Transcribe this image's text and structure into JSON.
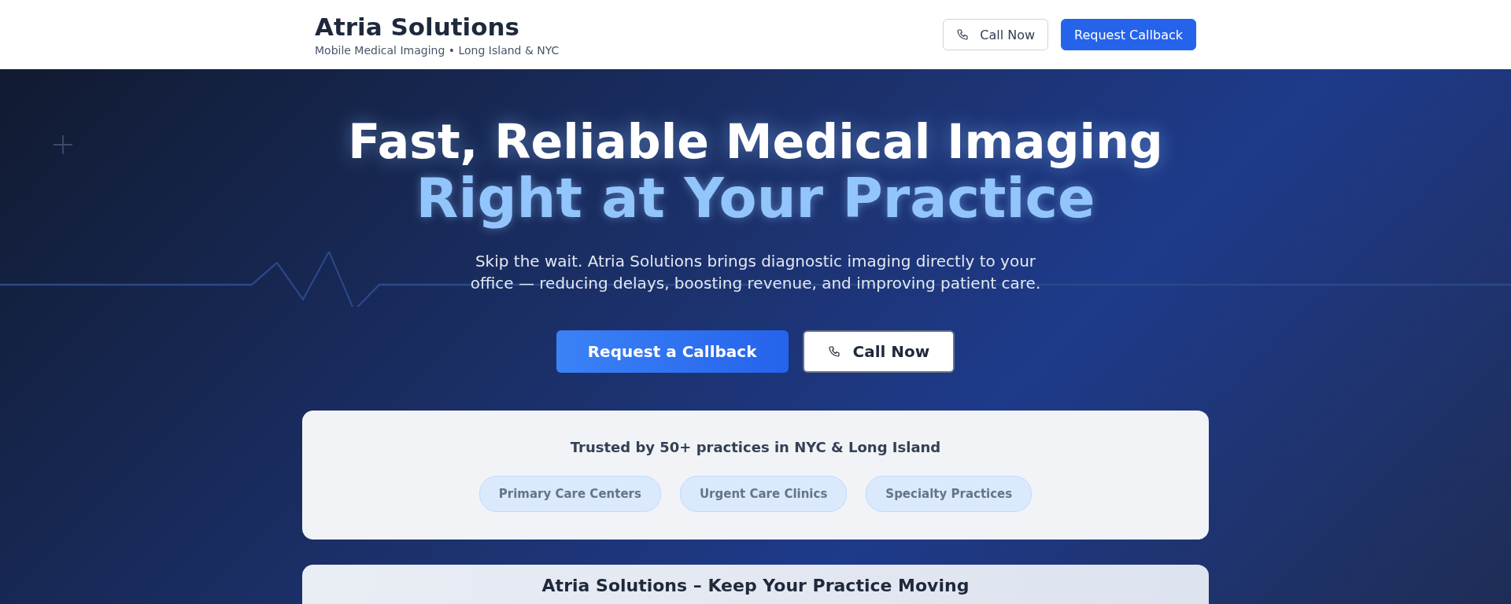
{
  "header": {
    "brand": "Atria Solutions",
    "tagline": "Mobile Medical Imaging • Long Island & NYC",
    "buttons": [
      {
        "label": "Call Now",
        "kind": "outline"
      },
      {
        "label": "Request Callback",
        "kind": "primary"
      }
    ]
  },
  "hero": {
    "title": "Fast, Reliable Medical Imaging",
    "highlight": "Right at Your Practice",
    "description": "Skip the wait. Atria Solutions brings diagnostic imaging directly to your office — reducing delays, boosting revenue, and improving patient care.",
    "buttons": [
      {
        "label": "Request a Callback",
        "kind": "primary"
      },
      {
        "label": "Call Now",
        "kind": "outline"
      }
    ]
  },
  "trust_card": {
    "title": "Trusted by 50+ practices in NYC & Long Island",
    "tags": [
      "Primary Care Centers",
      "Urgent Care Clinics",
      "Specialty Practices"
    ]
  },
  "next_card": {
    "title": "Atria Solutions – Keep Your Practice Moving"
  }
}
